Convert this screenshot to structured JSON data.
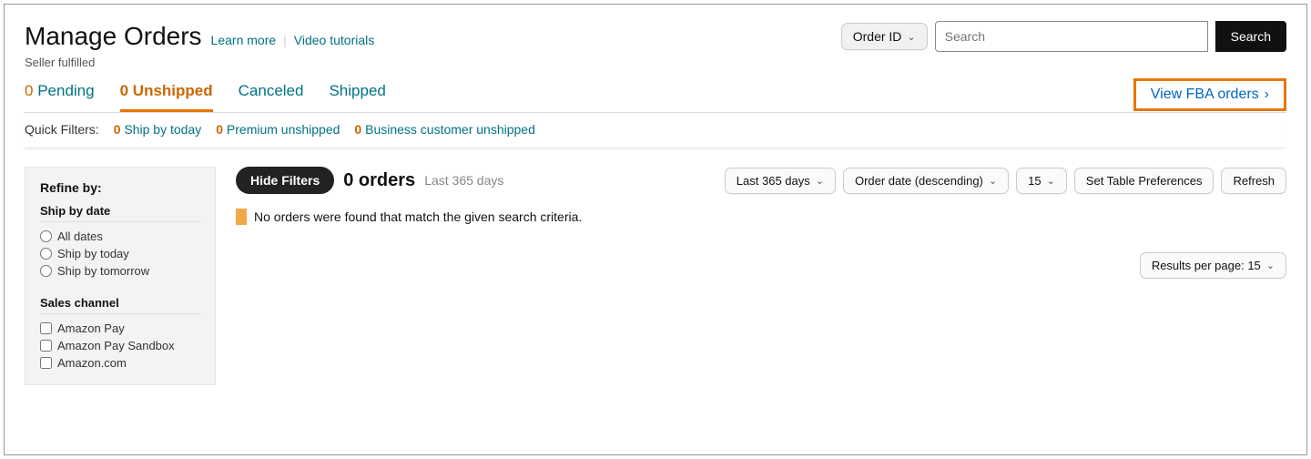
{
  "header": {
    "title": "Manage Orders",
    "learn_more": "Learn more",
    "video_tutorials": "Video tutorials",
    "subtitle": "Seller fulfilled",
    "order_id_dropdown": "Order ID",
    "search_placeholder": "Search",
    "search_button": "Search"
  },
  "tabs": {
    "pending_count": "0",
    "pending_label": "Pending",
    "unshipped_count": "0",
    "unshipped_label": "Unshipped",
    "canceled_label": "Canceled",
    "shipped_label": "Shipped",
    "fba_link": "View FBA orders"
  },
  "quick_filters": {
    "label": "Quick Filters:",
    "ship_today_count": "0",
    "ship_today_label": "Ship by today",
    "premium_count": "0",
    "premium_label": "Premium unshipped",
    "business_count": "0",
    "business_label": "Business customer unshipped"
  },
  "sidebar": {
    "refine_by": "Refine by:",
    "ship_by_date": "Ship by date",
    "all_dates": "All dates",
    "ship_by_today": "Ship by today",
    "ship_by_tomorrow": "Ship by tomorrow",
    "sales_channel": "Sales channel",
    "amazon_pay": "Amazon Pay",
    "amazon_pay_sandbox": "Amazon Pay Sandbox",
    "amazon_com": "Amazon.com"
  },
  "toolbar": {
    "hide_filters": "Hide Filters",
    "orders_count": "0 orders",
    "orders_sub": "Last 365 days",
    "range": "Last 365 days",
    "sort": "Order date (descending)",
    "page_size": "15",
    "table_prefs": "Set Table Preferences",
    "refresh": "Refresh"
  },
  "notice": {
    "text": "No orders were found that match the given search criteria."
  },
  "footer": {
    "results_per_page": "Results per page: 15"
  }
}
